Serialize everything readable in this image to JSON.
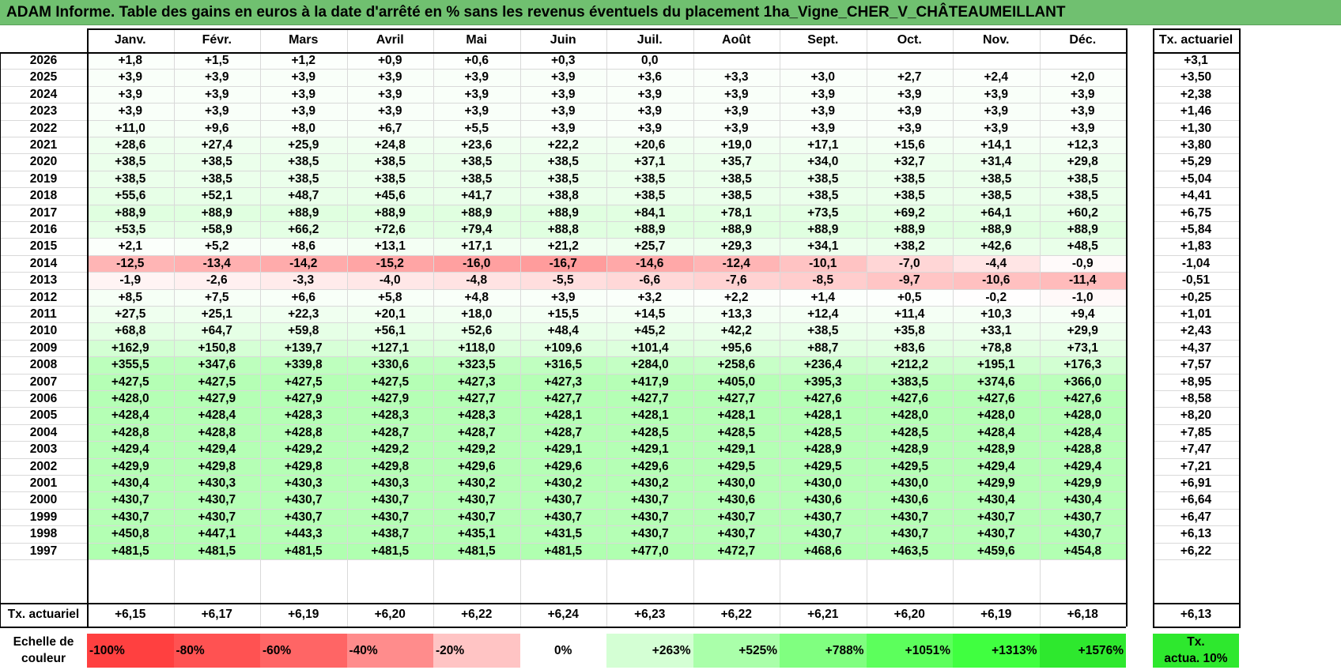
{
  "title": "ADAM Informe. Table des gains en euros à la date d'arrêté en % sans les revenus éventuels du placement 1ha_Vigne_CHER_V_CHÂTEAUMEILLANT",
  "table": {
    "months": [
      "Janv.",
      "Févr.",
      "Mars",
      "Avril",
      "Mai",
      "Juin",
      "Juil.",
      "Août",
      "Sept.",
      "Oct.",
      "Nov.",
      "Déc."
    ],
    "annual_header": "Tx. actuariel",
    "rows": [
      {
        "year": "2026",
        "values": [
          "+1,8",
          "+1,5",
          "+1,2",
          "+0,9",
          "+0,6",
          "+0,3",
          "0,0",
          "",
          "",
          "",
          "",
          ""
        ],
        "annual": "+3,1"
      },
      {
        "year": "2025",
        "values": [
          "+3,9",
          "+3,9",
          "+3,9",
          "+3,9",
          "+3,9",
          "+3,9",
          "+3,6",
          "+3,3",
          "+3,0",
          "+2,7",
          "+2,4",
          "+2,0"
        ],
        "annual": "+3,50"
      },
      {
        "year": "2024",
        "values": [
          "+3,9",
          "+3,9",
          "+3,9",
          "+3,9",
          "+3,9",
          "+3,9",
          "+3,9",
          "+3,9",
          "+3,9",
          "+3,9",
          "+3,9",
          "+3,9"
        ],
        "annual": "+2,38"
      },
      {
        "year": "2023",
        "values": [
          "+3,9",
          "+3,9",
          "+3,9",
          "+3,9",
          "+3,9",
          "+3,9",
          "+3,9",
          "+3,9",
          "+3,9",
          "+3,9",
          "+3,9",
          "+3,9"
        ],
        "annual": "+1,46"
      },
      {
        "year": "2022",
        "values": [
          "+11,0",
          "+9,6",
          "+8,0",
          "+6,7",
          "+5,5",
          "+3,9",
          "+3,9",
          "+3,9",
          "+3,9",
          "+3,9",
          "+3,9",
          "+3,9"
        ],
        "annual": "+1,30"
      },
      {
        "year": "2021",
        "values": [
          "+28,6",
          "+27,4",
          "+25,9",
          "+24,8",
          "+23,6",
          "+22,2",
          "+20,6",
          "+19,0",
          "+17,1",
          "+15,6",
          "+14,1",
          "+12,3"
        ],
        "annual": "+3,80"
      },
      {
        "year": "2020",
        "values": [
          "+38,5",
          "+38,5",
          "+38,5",
          "+38,5",
          "+38,5",
          "+38,5",
          "+37,1",
          "+35,7",
          "+34,0",
          "+32,7",
          "+31,4",
          "+29,8"
        ],
        "annual": "+5,29"
      },
      {
        "year": "2019",
        "values": [
          "+38,5",
          "+38,5",
          "+38,5",
          "+38,5",
          "+38,5",
          "+38,5",
          "+38,5",
          "+38,5",
          "+38,5",
          "+38,5",
          "+38,5",
          "+38,5"
        ],
        "annual": "+5,04"
      },
      {
        "year": "2018",
        "values": [
          "+55,6",
          "+52,1",
          "+48,7",
          "+45,6",
          "+41,7",
          "+38,8",
          "+38,5",
          "+38,5",
          "+38,5",
          "+38,5",
          "+38,5",
          "+38,5"
        ],
        "annual": "+4,41"
      },
      {
        "year": "2017",
        "values": [
          "+88,9",
          "+88,9",
          "+88,9",
          "+88,9",
          "+88,9",
          "+88,9",
          "+84,1",
          "+78,1",
          "+73,5",
          "+69,2",
          "+64,1",
          "+60,2"
        ],
        "annual": "+6,75"
      },
      {
        "year": "2016",
        "values": [
          "+53,5",
          "+58,9",
          "+66,2",
          "+72,6",
          "+79,4",
          "+88,8",
          "+88,9",
          "+88,9",
          "+88,9",
          "+88,9",
          "+88,9",
          "+88,9"
        ],
        "annual": "+5,84"
      },
      {
        "year": "2015",
        "values": [
          "+2,1",
          "+5,2",
          "+8,6",
          "+13,1",
          "+17,1",
          "+21,2",
          "+25,7",
          "+29,3",
          "+34,1",
          "+38,2",
          "+42,6",
          "+48,5"
        ],
        "annual": "+1,83"
      },
      {
        "year": "2014",
        "values": [
          "-12,5",
          "-13,4",
          "-14,2",
          "-15,2",
          "-16,0",
          "-16,7",
          "-14,6",
          "-12,4",
          "-10,1",
          "-7,0",
          "-4,4",
          "-0,9"
        ],
        "annual": "-1,04"
      },
      {
        "year": "2013",
        "values": [
          "-1,9",
          "-2,6",
          "-3,3",
          "-4,0",
          "-4,8",
          "-5,5",
          "-6,6",
          "-7,6",
          "-8,5",
          "-9,7",
          "-10,6",
          "-11,4"
        ],
        "annual": "-0,51"
      },
      {
        "year": "2012",
        "values": [
          "+8,5",
          "+7,5",
          "+6,6",
          "+5,8",
          "+4,8",
          "+3,9",
          "+3,2",
          "+2,2",
          "+1,4",
          "+0,5",
          "-0,2",
          "-1,0"
        ],
        "annual": "+0,25"
      },
      {
        "year": "2011",
        "values": [
          "+27,5",
          "+25,1",
          "+22,3",
          "+20,1",
          "+18,0",
          "+15,5",
          "+14,5",
          "+13,3",
          "+12,4",
          "+11,4",
          "+10,3",
          "+9,4"
        ],
        "annual": "+1,01"
      },
      {
        "year": "2010",
        "values": [
          "+68,8",
          "+64,7",
          "+59,8",
          "+56,1",
          "+52,6",
          "+48,4",
          "+45,2",
          "+42,2",
          "+38,5",
          "+35,8",
          "+33,1",
          "+29,9"
        ],
        "annual": "+2,43"
      },
      {
        "year": "2009",
        "values": [
          "+162,9",
          "+150,8",
          "+139,7",
          "+127,1",
          "+118,0",
          "+109,6",
          "+101,4",
          "+95,6",
          "+88,7",
          "+83,6",
          "+78,8",
          "+73,1"
        ],
        "annual": "+4,37"
      },
      {
        "year": "2008",
        "values": [
          "+355,5",
          "+347,6",
          "+339,8",
          "+330,6",
          "+323,5",
          "+316,5",
          "+284,0",
          "+258,6",
          "+236,4",
          "+212,2",
          "+195,1",
          "+176,3"
        ],
        "annual": "+7,57"
      },
      {
        "year": "2007",
        "values": [
          "+427,5",
          "+427,5",
          "+427,5",
          "+427,5",
          "+427,3",
          "+427,3",
          "+417,9",
          "+405,0",
          "+395,3",
          "+383,5",
          "+374,6",
          "+366,0"
        ],
        "annual": "+8,95"
      },
      {
        "year": "2006",
        "values": [
          "+428,0",
          "+427,9",
          "+427,9",
          "+427,9",
          "+427,7",
          "+427,7",
          "+427,7",
          "+427,7",
          "+427,6",
          "+427,6",
          "+427,6",
          "+427,6"
        ],
        "annual": "+8,58"
      },
      {
        "year": "2005",
        "values": [
          "+428,4",
          "+428,4",
          "+428,3",
          "+428,3",
          "+428,3",
          "+428,1",
          "+428,1",
          "+428,1",
          "+428,1",
          "+428,0",
          "+428,0",
          "+428,0"
        ],
        "annual": "+8,20"
      },
      {
        "year": "2004",
        "values": [
          "+428,8",
          "+428,8",
          "+428,8",
          "+428,7",
          "+428,7",
          "+428,7",
          "+428,5",
          "+428,5",
          "+428,5",
          "+428,5",
          "+428,4",
          "+428,4"
        ],
        "annual": "+7,85"
      },
      {
        "year": "2003",
        "values": [
          "+429,4",
          "+429,4",
          "+429,2",
          "+429,2",
          "+429,2",
          "+429,1",
          "+429,1",
          "+429,1",
          "+428,9",
          "+428,9",
          "+428,9",
          "+428,8"
        ],
        "annual": "+7,47"
      },
      {
        "year": "2002",
        "values": [
          "+429,9",
          "+429,8",
          "+429,8",
          "+429,8",
          "+429,6",
          "+429,6",
          "+429,6",
          "+429,5",
          "+429,5",
          "+429,5",
          "+429,4",
          "+429,4"
        ],
        "annual": "+7,21"
      },
      {
        "year": "2001",
        "values": [
          "+430,4",
          "+430,3",
          "+430,3",
          "+430,3",
          "+430,2",
          "+430,2",
          "+430,2",
          "+430,0",
          "+430,0",
          "+430,0",
          "+429,9",
          "+429,9"
        ],
        "annual": "+6,91"
      },
      {
        "year": "2000",
        "values": [
          "+430,7",
          "+430,7",
          "+430,7",
          "+430,7",
          "+430,7",
          "+430,7",
          "+430,7",
          "+430,6",
          "+430,6",
          "+430,6",
          "+430,4",
          "+430,4"
        ],
        "annual": "+6,64"
      },
      {
        "year": "1999",
        "values": [
          "+430,7",
          "+430,7",
          "+430,7",
          "+430,7",
          "+430,7",
          "+430,7",
          "+430,7",
          "+430,7",
          "+430,7",
          "+430,7",
          "+430,7",
          "+430,7"
        ],
        "annual": "+6,47"
      },
      {
        "year": "1998",
        "values": [
          "+450,8",
          "+447,1",
          "+443,3",
          "+438,7",
          "+435,1",
          "+431,5",
          "+430,7",
          "+430,7",
          "+430,7",
          "+430,7",
          "+430,7",
          "+430,7"
        ],
        "annual": "+6,13"
      },
      {
        "year": "1997",
        "values": [
          "+481,5",
          "+481,5",
          "+481,5",
          "+481,5",
          "+481,5",
          "+481,5",
          "+477,0",
          "+472,7",
          "+468,6",
          "+463,5",
          "+459,6",
          "+454,8"
        ],
        "annual": "+6,22"
      }
    ],
    "footer": {
      "label": "Tx. actuariel",
      "values": [
        "+6,15",
        "+6,17",
        "+6,19",
        "+6,20",
        "+6,22",
        "+6,24",
        "+6,23",
        "+6,22",
        "+6,21",
        "+6,20",
        "+6,19",
        "+6,18"
      ],
      "annual": "+6,13"
    }
  },
  "scale": {
    "label_line1": "Echelle de",
    "label_line2": "couleur",
    "steps": [
      {
        "label": "-100%",
        "color": "#ff4040"
      },
      {
        "label": "-80%",
        "color": "#ff5252"
      },
      {
        "label": "-60%",
        "color": "#ff6565"
      },
      {
        "label": "-40%",
        "color": "#ff8c8c"
      },
      {
        "label": "-20%",
        "color": "#ffc4c4"
      },
      {
        "label": "0%",
        "color": "#ffffff"
      },
      {
        "label": "+263%",
        "color": "#d4ffd4"
      },
      {
        "label": "+525%",
        "color": "#aaffaa"
      },
      {
        "label": "+788%",
        "color": "#80ff80"
      },
      {
        "label": "+1051%",
        "color": "#5cff5c"
      },
      {
        "label": "+1313%",
        "color": "#40ff40"
      },
      {
        "label": "+1576%",
        "color": "#2ee82e"
      }
    ],
    "legend_line1": "Tx.",
    "legend_line2": "actua. 10%",
    "legend_color": "#2ee82e"
  },
  "colors": {
    "title_bg": "#70c070",
    "negative_max": "#ff9c9c",
    "positive_max": "#b0ffb0"
  }
}
